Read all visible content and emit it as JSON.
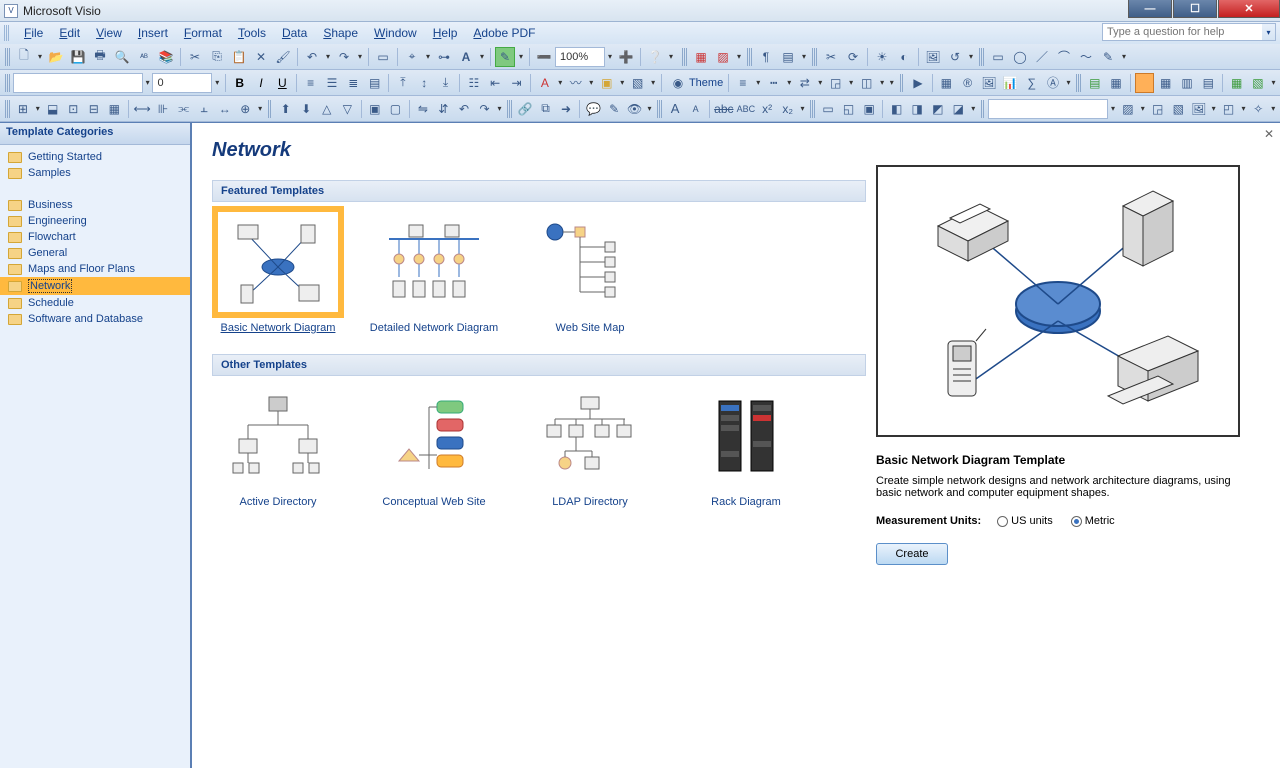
{
  "titlebar": {
    "app": "Microsoft Visio"
  },
  "menus": [
    "File",
    "Edit",
    "View",
    "Insert",
    "Format",
    "Tools",
    "Data",
    "Shape",
    "Window",
    "Help",
    "Adobe PDF"
  ],
  "help_placeholder": "Type a question for help",
  "zoom": "100%",
  "font_size_box": "0",
  "theme_label": "Theme",
  "sidebar": {
    "header": "Template Categories",
    "group1": [
      "Getting Started",
      "Samples"
    ],
    "group2": [
      "Business",
      "Engineering",
      "Flowchart",
      "General",
      "Maps and Floor Plans",
      "Network",
      "Schedule",
      "Software and Database"
    ],
    "selected": "Network"
  },
  "page": {
    "title": "Network",
    "section1": "Featured Templates",
    "section2": "Other Templates",
    "featured": [
      "Basic Network Diagram",
      "Detailed Network Diagram",
      "Web Site Map"
    ],
    "other": [
      "Active Directory",
      "Conceptual Web Site",
      "LDAP Directory",
      "Rack Diagram"
    ],
    "selected": "Basic Network Diagram"
  },
  "preview": {
    "title": "Basic Network Diagram Template",
    "desc": "Create simple network designs and network architecture diagrams, using basic network and computer equipment shapes.",
    "units_label": "Measurement Units:",
    "unit_us": "US units",
    "unit_metric": "Metric",
    "selected_unit": "Metric",
    "create": "Create"
  }
}
